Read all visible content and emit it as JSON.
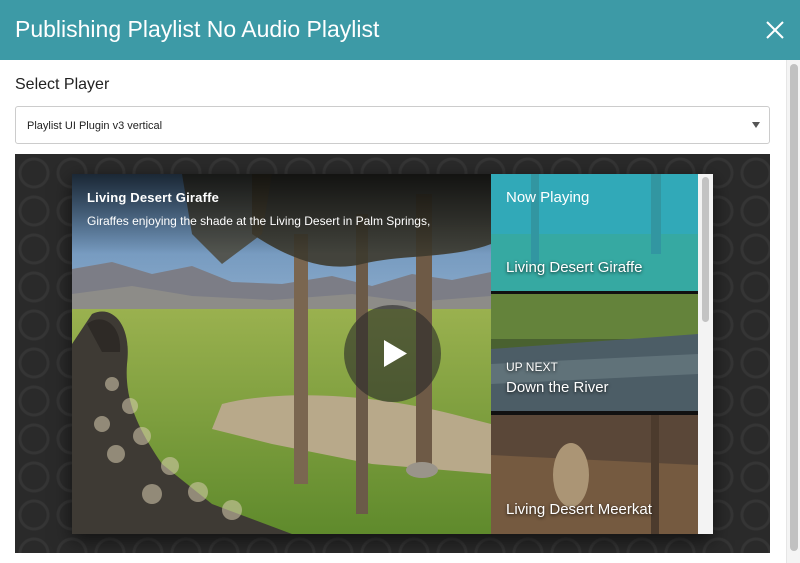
{
  "modal": {
    "title": "Publishing Playlist No Audio Playlist",
    "close_icon": "close-icon"
  },
  "player_select": {
    "label": "Select Player",
    "selected": "Playlist UI Plugin v3 vertical"
  },
  "player": {
    "current_title": "Living Desert Giraffe",
    "current_description": "Giraffes enjoying the shade at the Living Desert in Palm Springs,",
    "play_icon": "play-icon",
    "playlist": [
      {
        "status": "Now Playing",
        "title": "Living Desert Giraffe"
      },
      {
        "status": "UP NEXT",
        "title": "Down the River"
      },
      {
        "status": "",
        "title": "Living Desert Meerkat"
      }
    ]
  },
  "colors": {
    "header": "#3d9aa6",
    "now_playing_overlay": "#2ab3c6"
  }
}
